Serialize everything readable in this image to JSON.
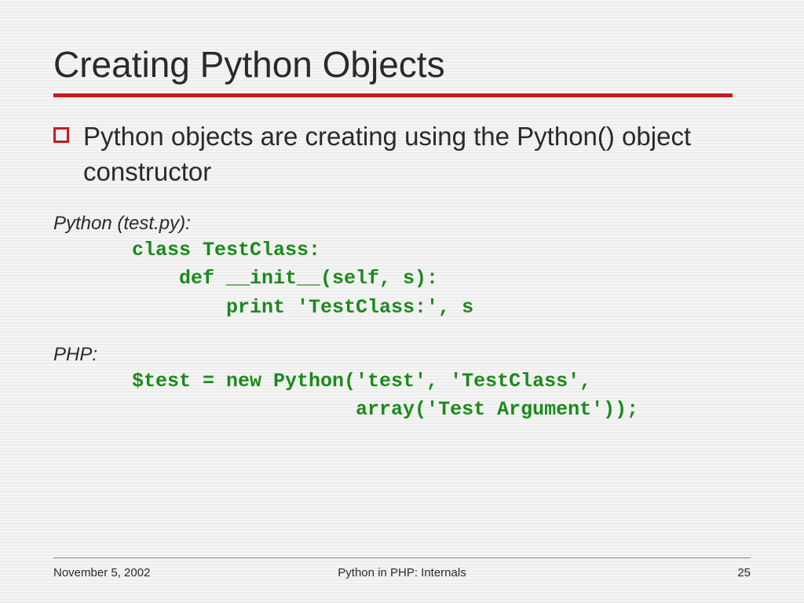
{
  "slide": {
    "title": "Creating Python Objects",
    "bullet_text": "Python objects are creating using the Python() object constructor",
    "python_label": "Python (test.py):",
    "python_code_line1": "class TestClass:",
    "python_code_line2": "    def __init__(self, s):",
    "python_code_line3": "        print 'TestClass:', s",
    "php_label": "PHP:",
    "php_code_line1": "$test = new Python('test', 'TestClass',",
    "php_code_line2": "                   array('Test Argument'));"
  },
  "footer": {
    "date": "November 5, 2002",
    "title": "Python in PHP: Internals",
    "page": "25"
  },
  "colors": {
    "accent": "#c41e1e",
    "code_green": "#1a8a1a"
  }
}
